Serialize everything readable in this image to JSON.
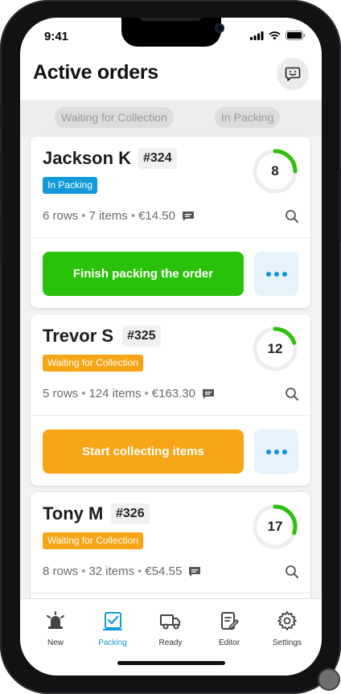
{
  "status_bar": {
    "time": "9:41"
  },
  "header": {
    "title": "Active orders",
    "chat_icon": "chat-icon"
  },
  "filters": [
    {
      "label": "Waiting for Collection"
    },
    {
      "label": "In Packing"
    }
  ],
  "orders": [
    {
      "name": "Jackson K",
      "number": "#324",
      "status": "In Packing",
      "status_color": "#1199d9",
      "progress_value": "8",
      "progress_fraction": 0.25,
      "rows": "6 rows",
      "items": "7 items",
      "total": "€14.50",
      "action_label": "Finish packing the order",
      "action_color": "#2ac10b"
    },
    {
      "name": "Trevor S",
      "number": "#325",
      "status": "Waiting for Collection",
      "status_color": "#f7a516",
      "progress_value": "12",
      "progress_fraction": 0.2,
      "rows": "5 rows",
      "items": "124 items",
      "total": "€163.30",
      "action_label": "Start collecting items",
      "action_color": "#f7a516"
    },
    {
      "name": "Tony M",
      "number": "#326",
      "status": "Waiting for Collection",
      "status_color": "#f7a516",
      "progress_value": "17",
      "progress_fraction": 0.3,
      "rows": "8 rows",
      "items": "32 items",
      "total": "€54.55"
    }
  ],
  "tabbar": {
    "items": [
      {
        "label": "New",
        "icon": "bell-icon"
      },
      {
        "label": "Packing",
        "icon": "packing-icon",
        "active": true
      },
      {
        "label": "Ready",
        "icon": "truck-icon"
      },
      {
        "label": "Editor",
        "icon": "editor-icon"
      },
      {
        "label": "Settings",
        "icon": "gear-icon"
      }
    ]
  },
  "colors": {
    "accent": "#1199d9",
    "progress": "#2ac10b",
    "waiting": "#f7a516"
  }
}
